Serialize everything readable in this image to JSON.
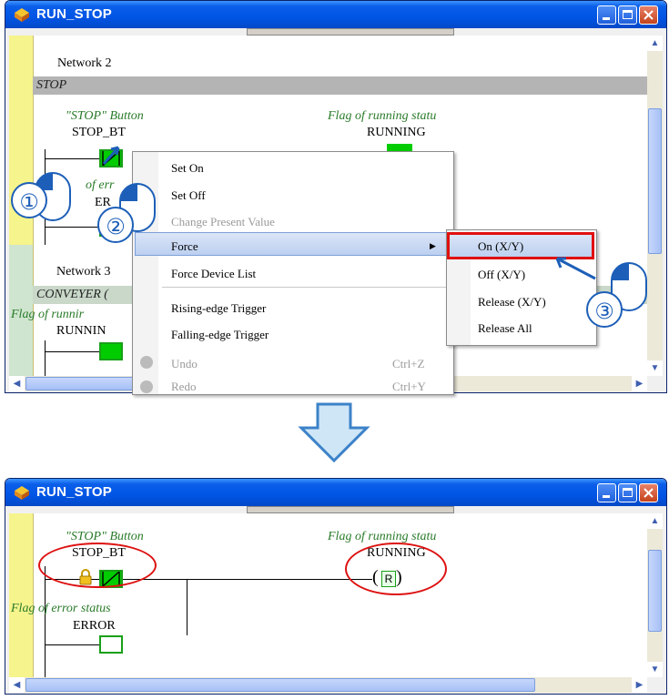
{
  "window_top": {
    "title": "RUN_STOP",
    "network2_label": "Network 2",
    "network2_comment": "STOP",
    "stop_comment": "\"STOP\" Button",
    "stop_device": "STOP_BT",
    "flag_running_comment": "Flag of running statu",
    "running_device": "RUNNING",
    "error_comment_partial": "of err",
    "error_device_partial": "ER",
    "network3_label": "Network 3",
    "network3_comment": "CONVEYER (",
    "flag_running_comment2": "Flag of runnir",
    "running_device2": "RUNNIN"
  },
  "context_menu": {
    "items": [
      {
        "label": "Set On",
        "shortcut": "",
        "disabled": false
      },
      {
        "label": "Set Off",
        "shortcut": "",
        "disabled": false
      },
      {
        "label": "Change Present Value",
        "shortcut": "",
        "disabled": true
      },
      {
        "label": "Force",
        "shortcut": "",
        "disabled": false
      },
      {
        "label": "Force Device List",
        "shortcut": "",
        "disabled": false
      },
      {
        "label": "Rising-edge Trigger",
        "shortcut": "",
        "disabled": false
      },
      {
        "label": "Falling-edge Trigger",
        "shortcut": "",
        "disabled": false
      },
      {
        "label": "Undo",
        "shortcut": "Ctrl+Z",
        "disabled": true
      },
      {
        "label": "Redo",
        "shortcut": "Ctrl+Y",
        "disabled": true
      }
    ]
  },
  "force_submenu": {
    "items": [
      "On (X/Y)",
      "Off (X/Y)",
      "Release (X/Y)",
      "Release All"
    ]
  },
  "steps": [
    "①",
    "②",
    "③"
  ],
  "window_bottom": {
    "title": "RUN_STOP",
    "stop_comment": "\"STOP\" Button",
    "stop_device": "STOP_BT",
    "flag_running_comment": "Flag of running statu",
    "running_device": "RUNNING",
    "coil_letter": "R",
    "error_comment": "Flag of error status",
    "error_device": "ERROR"
  },
  "colors": {
    "title_blue": "#0055e5",
    "contact_green": "#00cc00",
    "comment_green": "#2a7b2a",
    "highlight_red": "#e01010",
    "step_blue": "#1d5fb8"
  }
}
